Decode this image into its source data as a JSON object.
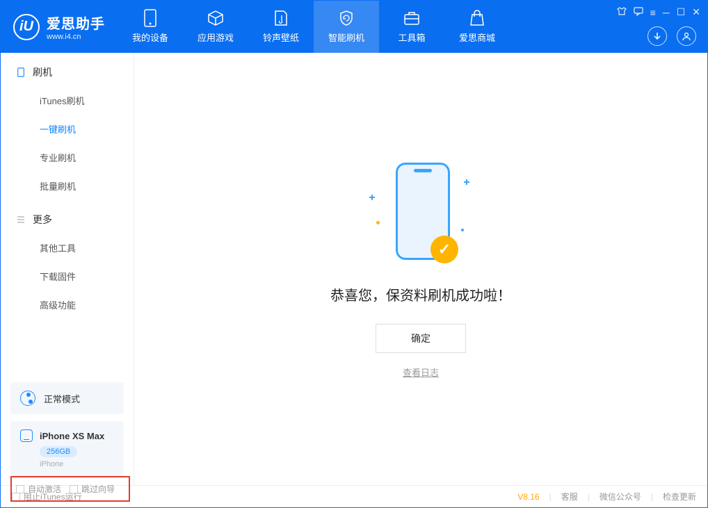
{
  "app": {
    "title": "爱思助手",
    "subtitle": "www.i4.cn",
    "logo_letter": "iU"
  },
  "nav": [
    {
      "label": "我的设备"
    },
    {
      "label": "应用游戏"
    },
    {
      "label": "铃声壁纸"
    },
    {
      "label": "智能刷机"
    },
    {
      "label": "工具箱"
    },
    {
      "label": "爱思商城"
    }
  ],
  "sidebar": {
    "section1_title": "刷机",
    "items1": [
      {
        "label": "iTunes刷机"
      },
      {
        "label": "一键刷机"
      },
      {
        "label": "专业刷机"
      },
      {
        "label": "批量刷机"
      }
    ],
    "section2_title": "更多",
    "items2": [
      {
        "label": "其他工具"
      },
      {
        "label": "下载固件"
      },
      {
        "label": "高级功能"
      }
    ]
  },
  "device": {
    "mode": "正常模式",
    "name": "iPhone XS Max",
    "storage": "256GB",
    "type": "iPhone"
  },
  "content": {
    "success_text": "恭喜您，保资料刷机成功啦！",
    "ok_button": "确定",
    "view_log": "查看日志",
    "check_mark": "✓"
  },
  "checkboxes": {
    "auto_activate": "自动激活",
    "skip_guide": "跳过向导"
  },
  "footer": {
    "stop_itunes": "阻止iTunes运行",
    "version": "V8.16",
    "support": "客服",
    "wechat": "微信公众号",
    "check_update": "检查更新"
  }
}
